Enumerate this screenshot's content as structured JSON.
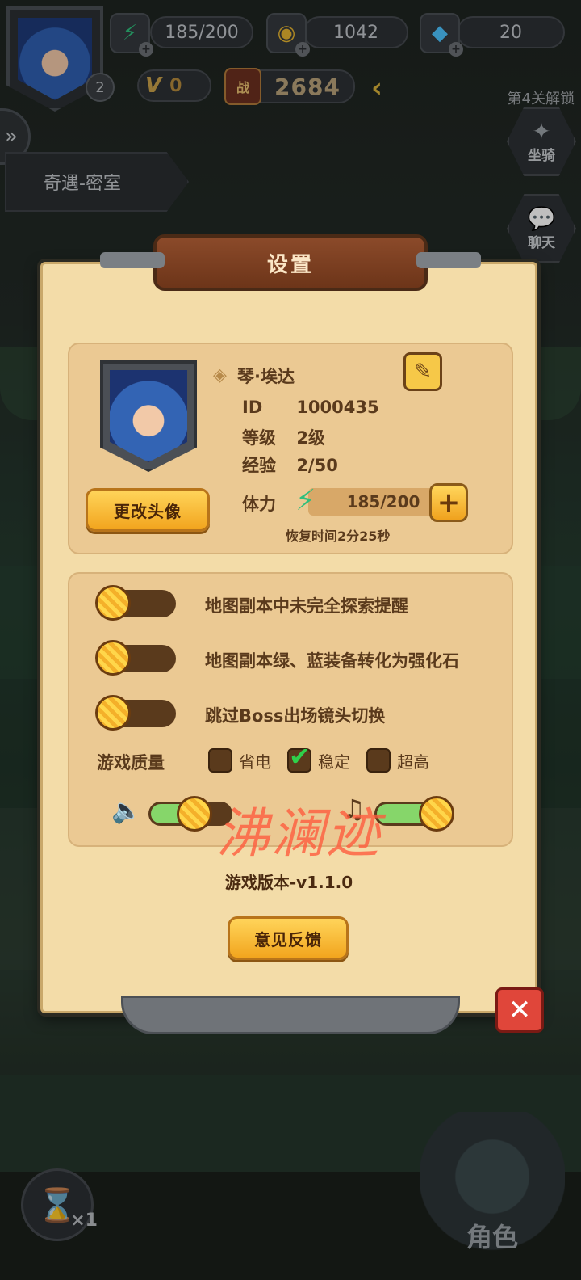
{
  "hud": {
    "player_level": "2",
    "stamina": "185/200",
    "gold": "1042",
    "diamonds": "20",
    "vip_level": "0",
    "power_badge": "战",
    "power": "2684",
    "unlock_hint": "第4关解锁",
    "mount_label": "坐骑",
    "chat_label": "聊天",
    "stage_name": "奇遇-密室",
    "speed": "×1",
    "role_label": "角色"
  },
  "settings": {
    "title": "设置",
    "profile": {
      "name": "琴·埃达",
      "id_label": "ID",
      "id_value": "1000435",
      "level_label": "等级",
      "level_value": "2级",
      "exp_label": "经验",
      "exp_value": "2/50",
      "stamina_label": "体力",
      "stamina_value": "185/200",
      "recover_text": "恢复时间2分25秒",
      "change_avatar_label": "更改头像"
    },
    "options": [
      {
        "label": "地图副本中未完全探索提醒",
        "on": false
      },
      {
        "label": "地图副本绿、蓝装备转化为强化石",
        "on": false
      },
      {
        "label": "跳过Boss出场镜头切换",
        "on": false
      }
    ],
    "quality": {
      "label": "游戏质量",
      "choices": [
        {
          "label": "省电",
          "checked": false
        },
        {
          "label": "稳定",
          "checked": true
        },
        {
          "label": "超高",
          "checked": false
        }
      ]
    },
    "sound_volume": 0.55,
    "music_volume": 0.8,
    "version": "游戏版本-v1.1.0",
    "watermark": "沸澜迹",
    "feedback_label": "意见反馈"
  },
  "colors": {
    "panel_bg": "#f3dca8",
    "title_bar": "#8b4a2a",
    "accent_button": "#f2a51e",
    "close_button": "#e0463a",
    "slider_fill": "#86d66a",
    "check_mark": "#2fd04a"
  },
  "icons": {
    "stamina": "lightning-bolt-icon",
    "gold": "coin-icon",
    "diamonds": "gem-icon",
    "vip": "vip-wing-icon",
    "sound": "speaker-icon",
    "music": "music-note-icon",
    "edit": "edit-note-icon",
    "close": "close-icon",
    "hourglass": "hourglass-icon"
  }
}
